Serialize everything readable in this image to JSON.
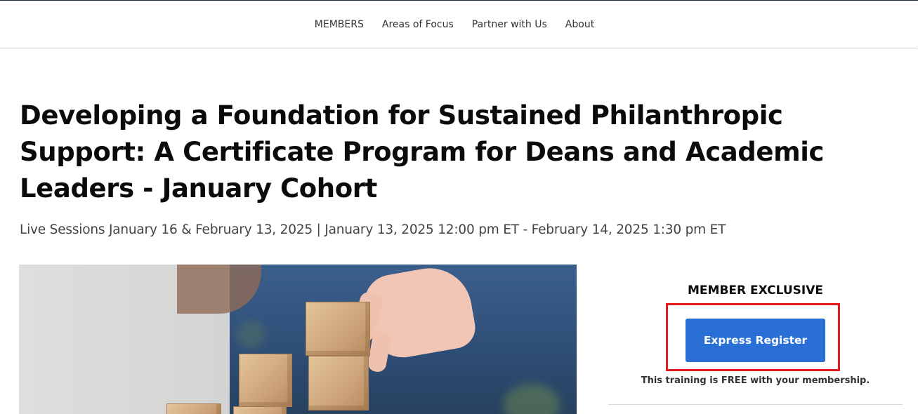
{
  "nav": {
    "items": [
      {
        "label": "MEMBERS"
      },
      {
        "label": "Areas of Focus"
      },
      {
        "label": "Partner with Us"
      },
      {
        "label": "About"
      }
    ]
  },
  "event": {
    "title": "Developing a Foundation for Sustained Philanthropic Support: A Certificate Program for Deans and Academic Leaders - January Cohort",
    "meta": "Live Sessions January 16 & February 13, 2025 | January 13, 2025 12:00 pm ET - February 14, 2025 1:30 pm ET",
    "image_description": "Hand stacking wooden blocks"
  },
  "sidebar": {
    "member_label": "MEMBER EXCLUSIVE",
    "register_label": "Express Register",
    "free_note": "This training is FREE with your membership."
  },
  "colors": {
    "button": "#2a6fd6",
    "highlight": "#e01b1b",
    "title": "#0b0b0b"
  }
}
